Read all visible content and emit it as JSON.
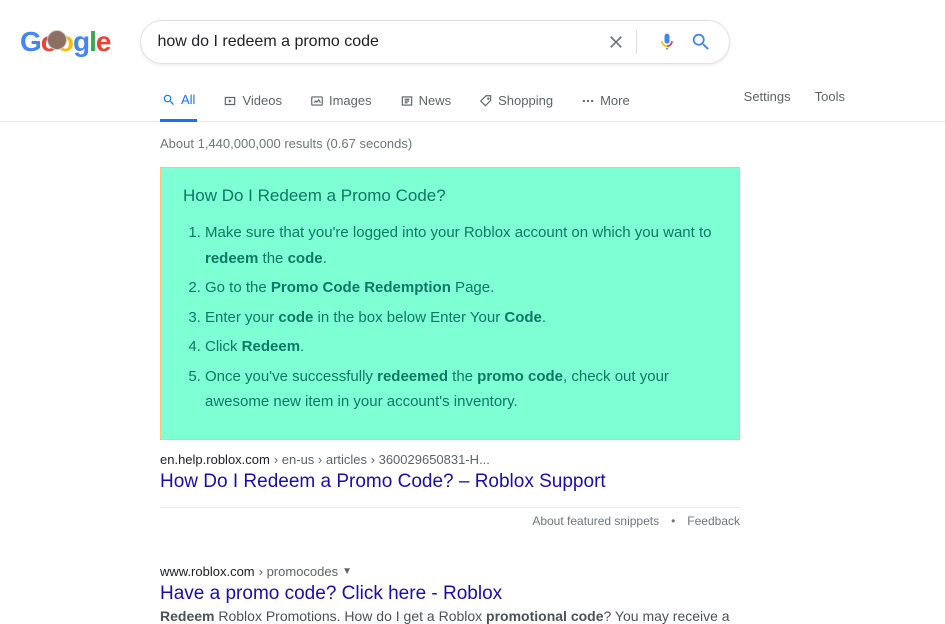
{
  "logo_text": "Google",
  "search": {
    "value": "how do I redeem a promo code",
    "placeholder": ""
  },
  "tabs": {
    "all": "All",
    "videos": "Videos",
    "images": "Images",
    "news": "News",
    "shopping": "Shopping",
    "more": "More"
  },
  "tools": {
    "settings": "Settings",
    "tools": "Tools"
  },
  "stats": "About 1,440,000,000 results (0.67 seconds)",
  "snippet": {
    "title": "How Do I Redeem a Promo Code?",
    "step1_a": "Make sure that you're logged into your Roblox account on which you want to ",
    "step1_b": "redeem",
    "step1_c": " the ",
    "step1_d": "code",
    "step1_e": ".",
    "step2_a": "Go to the ",
    "step2_b": "Promo Code Redemption",
    "step2_c": " Page.",
    "step3_a": "Enter your ",
    "step3_b": "code",
    "step3_c": " in the box below Enter Your ",
    "step3_d": "Code",
    "step3_e": ".",
    "step4_a": "Click ",
    "step4_b": "Redeem",
    "step4_c": ".",
    "step5_a": "Once you've successfully ",
    "step5_b": "redeemed",
    "step5_c": " the ",
    "step5_d": "promo code",
    "step5_e": ", check out your awesome new item in your account's inventory."
  },
  "result1": {
    "domain": "en.help.roblox.com",
    "path": " › en-us › articles › 360029650831-H...",
    "title": "How Do I Redeem a Promo Code? – Roblox Support"
  },
  "feedback": {
    "about": "About featured snippets",
    "fb": "Feedback"
  },
  "result2": {
    "domain": "www.roblox.com",
    "path": " › promocodes",
    "title": "Have a promo code? Click here - Roblox",
    "text_a": "Redeem",
    "text_b": " Roblox Promotions. How do I get a Roblox ",
    "text_c": "promotional code",
    "text_d": "? You may receive a"
  }
}
